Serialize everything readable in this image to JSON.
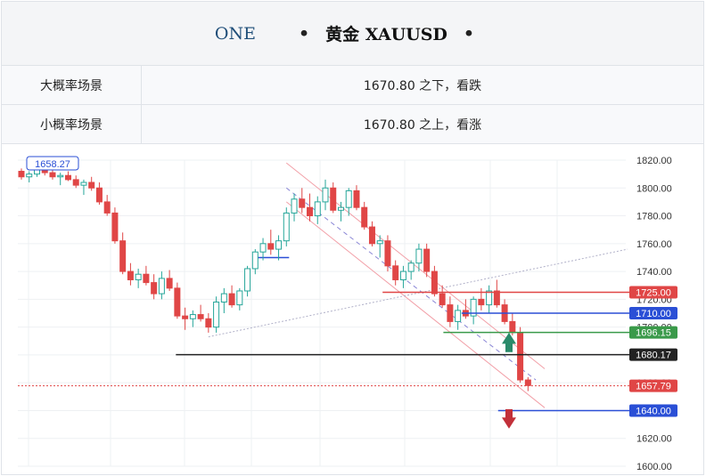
{
  "header": {
    "code": "ONE",
    "dot1": "•",
    "title": "黄金 XAUUSD",
    "dot2": "•"
  },
  "scenarios": [
    {
      "label": "大概率场景",
      "value": "1670.80 之下，看跌"
    },
    {
      "label": "小概率场景",
      "value": "1670.80 之上，看涨"
    }
  ],
  "colors": {
    "up": "#26a69a",
    "down": "#e04646",
    "red_line": "#e04646",
    "blue_line": "#2a4fd6",
    "green_line": "#2e7d32",
    "black_line": "#222222",
    "channel": "#f2a0a8"
  },
  "chart_data": {
    "type": "candlestick",
    "ylim": [
      1600,
      1820
    ],
    "y_ticks": [
      1600,
      1620,
      1640,
      1660,
      1680,
      1700,
      1720,
      1740,
      1760,
      1780,
      1800,
      1820
    ],
    "y_tick_labels": [
      "1600.00",
      "1620.00",
      "1640.00",
      "1660.00",
      "1680.00",
      "1700.00",
      "1720.00",
      "1740.00",
      "1760.00",
      "1780.00",
      "1800.00",
      "1820.00"
    ],
    "top_left_label": "1658.27",
    "levels": [
      {
        "value": 1725.0,
        "label": "1725.00",
        "color": "#e04646",
        "from": 0.6
      },
      {
        "value": 1710.0,
        "label": "1710.00",
        "color": "#2a4fd6",
        "from": 0.73
      },
      {
        "value": 1696.15,
        "label": "1696.15",
        "color": "#3a9a4a",
        "from": 0.7
      },
      {
        "value": 1680.17,
        "label": "1680.17",
        "color": "#222222",
        "from": 0.26
      },
      {
        "value": 1657.79,
        "label": "1657.79",
        "color": "#e04646",
        "from": 0,
        "dotted": true
      },
      {
        "value": 1640.0,
        "label": "1640.00",
        "color": "#2a4fd6",
        "from": 0.79
      }
    ],
    "candles": [
      [
        1812,
        1814,
        1806,
        1808
      ],
      [
        1808,
        1812,
        1804,
        1810
      ],
      [
        1810,
        1815,
        1808,
        1813
      ],
      [
        1813,
        1816,
        1809,
        1811
      ],
      [
        1811,
        1813,
        1806,
        1808
      ],
      [
        1808,
        1811,
        1802,
        1809
      ],
      [
        1809,
        1812,
        1805,
        1806
      ],
      [
        1806,
        1809,
        1800,
        1802
      ],
      [
        1802,
        1806,
        1795,
        1804
      ],
      [
        1804,
        1808,
        1798,
        1800
      ],
      [
        1800,
        1804,
        1788,
        1790
      ],
      [
        1790,
        1795,
        1780,
        1782
      ],
      [
        1782,
        1786,
        1760,
        1762
      ],
      [
        1762,
        1768,
        1738,
        1740
      ],
      [
        1740,
        1746,
        1730,
        1734
      ],
      [
        1734,
        1742,
        1728,
        1738
      ],
      [
        1738,
        1744,
        1730,
        1732
      ],
      [
        1732,
        1738,
        1720,
        1724
      ],
      [
        1724,
        1740,
        1720,
        1735
      ],
      [
        1735,
        1741,
        1726,
        1728
      ],
      [
        1728,
        1732,
        1706,
        1708
      ],
      [
        1708,
        1714,
        1698,
        1706
      ],
      [
        1706,
        1712,
        1700,
        1709
      ],
      [
        1709,
        1716,
        1704,
        1706
      ],
      [
        1706,
        1710,
        1696,
        1700
      ],
      [
        1700,
        1722,
        1696,
        1718
      ],
      [
        1718,
        1728,
        1710,
        1724
      ],
      [
        1724,
        1730,
        1714,
        1716
      ],
      [
        1716,
        1728,
        1712,
        1726
      ],
      [
        1726,
        1744,
        1722,
        1742
      ],
      [
        1742,
        1756,
        1738,
        1754
      ],
      [
        1754,
        1764,
        1748,
        1760
      ],
      [
        1760,
        1770,
        1752,
        1756
      ],
      [
        1756,
        1766,
        1748,
        1762
      ],
      [
        1762,
        1786,
        1758,
        1782
      ],
      [
        1782,
        1796,
        1776,
        1792
      ],
      [
        1792,
        1800,
        1782,
        1786
      ],
      [
        1786,
        1796,
        1776,
        1780
      ],
      [
        1780,
        1794,
        1774,
        1790
      ],
      [
        1790,
        1806,
        1784,
        1800
      ],
      [
        1800,
        1804,
        1782,
        1784
      ],
      [
        1784,
        1790,
        1776,
        1786
      ],
      [
        1786,
        1800,
        1780,
        1798
      ],
      [
        1798,
        1802,
        1784,
        1786
      ],
      [
        1786,
        1790,
        1770,
        1772
      ],
      [
        1772,
        1776,
        1758,
        1760
      ],
      [
        1760,
        1766,
        1750,
        1762
      ],
      [
        1762,
        1766,
        1740,
        1744
      ],
      [
        1744,
        1748,
        1730,
        1734
      ],
      [
        1734,
        1744,
        1728,
        1740
      ],
      [
        1740,
        1748,
        1734,
        1746
      ],
      [
        1746,
        1760,
        1740,
        1756
      ],
      [
        1756,
        1760,
        1736,
        1740
      ],
      [
        1740,
        1744,
        1722,
        1724
      ],
      [
        1724,
        1730,
        1714,
        1716
      ],
      [
        1716,
        1722,
        1700,
        1704
      ],
      [
        1704,
        1716,
        1698,
        1712
      ],
      [
        1712,
        1720,
        1706,
        1708
      ],
      [
        1708,
        1722,
        1702,
        1720
      ],
      [
        1720,
        1728,
        1712,
        1716
      ],
      [
        1716,
        1730,
        1710,
        1726
      ],
      [
        1726,
        1734,
        1714,
        1716
      ],
      [
        1716,
        1720,
        1702,
        1704
      ],
      [
        1704,
        1710,
        1694,
        1696
      ],
      [
        1696,
        1700,
        1660,
        1662
      ],
      [
        1662,
        1664,
        1654,
        1658
      ]
    ]
  }
}
